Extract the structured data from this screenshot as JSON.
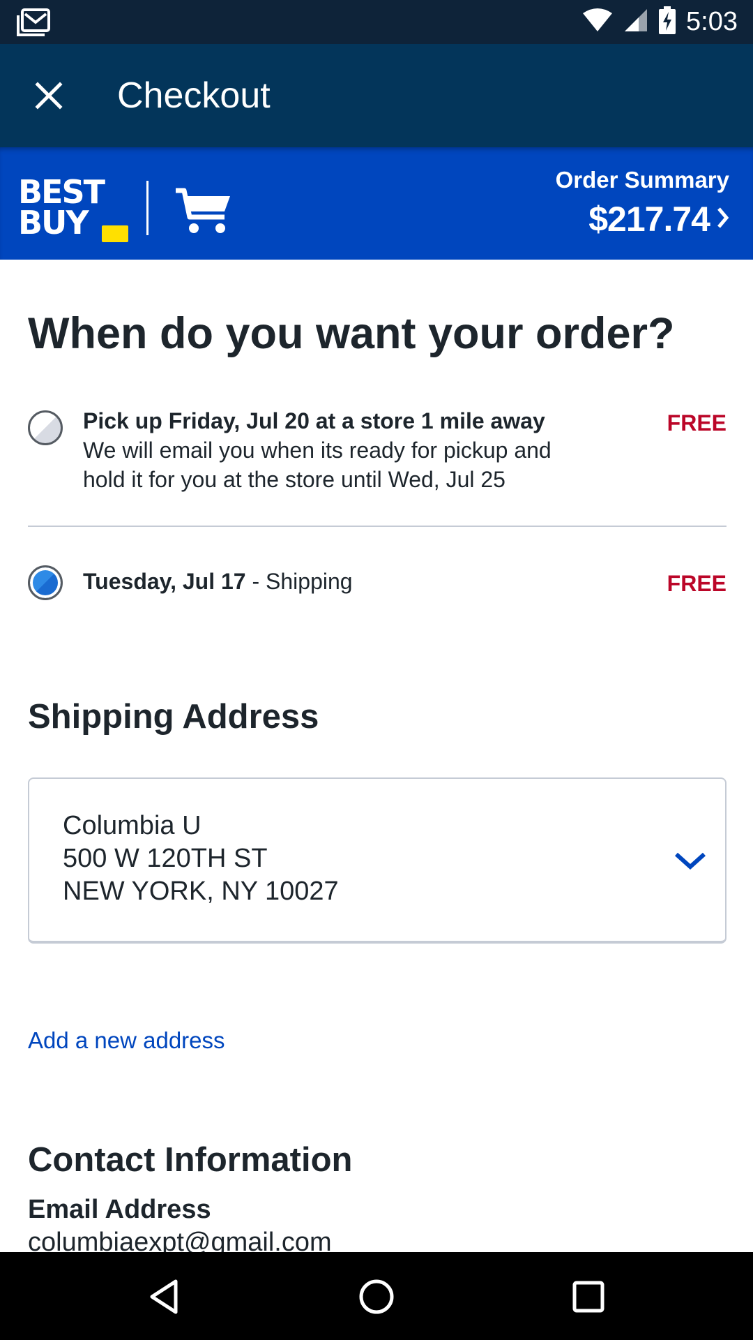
{
  "status_bar": {
    "time": "5:03"
  },
  "app_bar": {
    "title": "Checkout"
  },
  "banner": {
    "logo_word1": "BEST",
    "logo_word2": "BUY",
    "order_summary_label": "Order Summary",
    "order_total": "$217.74"
  },
  "delivery": {
    "heading": "When do you want your order?",
    "pickup": {
      "title": "Pick up Friday, Jul 20 at a store 1 mile away",
      "description_line1": "We will email you when its ready for pickup and",
      "description_line2": "hold it for you at the store until Wed, Jul 25",
      "price": "FREE",
      "selected": false
    },
    "shipping": {
      "date": "Tuesday, Jul 17",
      "method": " - Shipping",
      "price": "FREE",
      "selected": true
    }
  },
  "shipping_address": {
    "heading": "Shipping Address",
    "name": "Columbia U",
    "street": "500 W 120TH ST",
    "city_state_zip": "NEW YORK, NY 10027",
    "add_new_link": "Add a new address"
  },
  "contact": {
    "heading": "Contact Information",
    "email_label": "Email Address",
    "email_value": "columbiaexpt@gmail.com"
  },
  "colors": {
    "status_bar": "#0e2339",
    "app_bar": "#03355a",
    "brand_blue": "#0046be",
    "brand_yellow": "#ffe000",
    "price_red": "#bb0628"
  }
}
